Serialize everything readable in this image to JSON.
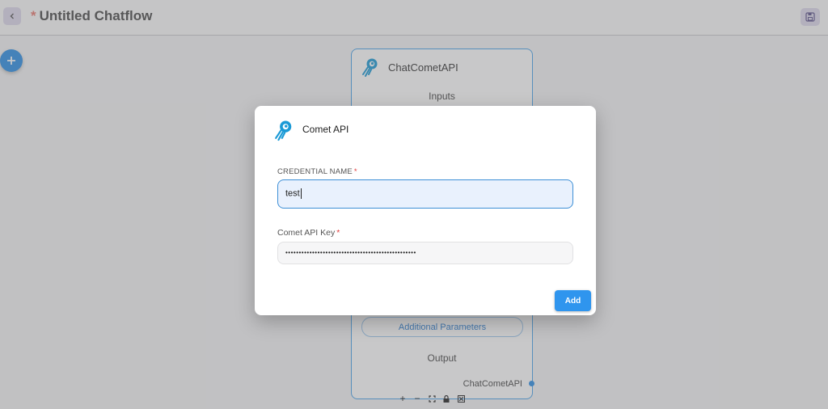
{
  "header": {
    "unsaved_marker": "*",
    "title": "Untitled Chatflow"
  },
  "canvas": {
    "node": {
      "title": "ChatCometAPI",
      "inputs_label": "Inputs",
      "additional_params_label": "Additional Parameters",
      "output_label": "Output",
      "output_name": "ChatCometAPI"
    },
    "controls": [
      "+",
      "−",
      "⛶",
      "🔒",
      "⊠"
    ]
  },
  "dialog": {
    "title": "Comet API",
    "credential_name": {
      "label": "CREDENTIAL NAME",
      "required_marker": "*",
      "value": "test"
    },
    "api_key": {
      "label": "Comet API Key",
      "required_marker": "*",
      "value": "•••••••••••••••••••••••••••••••••••••••••••••••••"
    },
    "add_button": "Add"
  },
  "colors": {
    "accent": "#2f95ee",
    "node_border": "#4aa3ea",
    "required": "#e03b3b",
    "unsaved_star": "#e9786f"
  }
}
